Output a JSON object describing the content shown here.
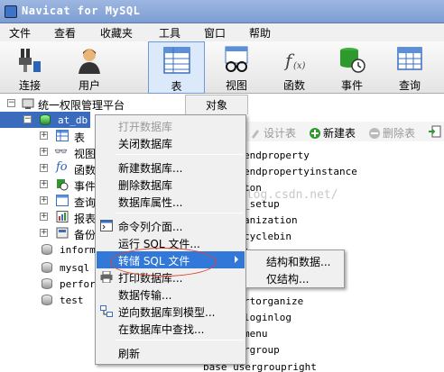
{
  "window": {
    "title": "Navicat for MySQL"
  },
  "menubar": [
    "文件",
    "查看",
    "收藏夹",
    "工具",
    "窗口",
    "帮助"
  ],
  "toolbar": [
    {
      "label": "连接",
      "icon": "connection-icon"
    },
    {
      "label": "用户",
      "icon": "user-icon"
    },
    {
      "label": "表",
      "icon": "table-icon",
      "active": true
    },
    {
      "label": "视图",
      "icon": "view-icon"
    },
    {
      "label": "函数",
      "icon": "function-icon"
    },
    {
      "label": "事件",
      "icon": "event-icon"
    },
    {
      "label": "查询",
      "icon": "query-icon"
    }
  ],
  "tree": {
    "root": "统一权限管理平台",
    "selected_db": "at_db",
    "children": [
      "表",
      "视图",
      "函数",
      "事件",
      "查询",
      "报表",
      "备份"
    ],
    "other_dbs": [
      "information_schema",
      "mysql",
      "performance_schema",
      "test"
    ],
    "visible_labels": {
      "info": "informa",
      "mysql": "mysql",
      "perf": "perform",
      "test": "test"
    }
  },
  "objects": {
    "tab": "对象",
    "toolbar": {
      "design": "设计表",
      "new": "新建表",
      "delete": "删除表"
    },
    "items": [
      "endproperty",
      "endpropertyinstance",
      "ton",
      "_setup",
      "anization",
      "cyclebin",
      "ion",
      "rtorganize",
      "loginlog",
      "menu",
      "rgroup",
      "base_usergroupright"
    ],
    "watermark": "blog.csdn.net/"
  },
  "context_menu": [
    {
      "label": "打开数据库",
      "disabled": true
    },
    {
      "label": "关闭数据库"
    },
    {
      "sep": true
    },
    {
      "label": "新建数据库..."
    },
    {
      "label": "删除数据库"
    },
    {
      "label": "数据库属性..."
    },
    {
      "sep": true
    },
    {
      "label": "命令列介面...",
      "icon": "console-icon"
    },
    {
      "label": "运行 SQL 文件..."
    },
    {
      "label": "转储 SQL 文件",
      "highlight": true,
      "submenu": true
    },
    {
      "label": "打印数据库...",
      "icon": "printer-icon"
    },
    {
      "label": "数据传输..."
    },
    {
      "label": "逆向数据库到模型...",
      "icon": "model-icon"
    },
    {
      "label": "在数据库中查找..."
    },
    {
      "sep": true
    },
    {
      "label": "刷新"
    }
  ],
  "submenu": [
    "结构和数据...",
    "仅结构..."
  ],
  "colors": {
    "highlight": "#3178d8",
    "selection": "#3b6bbd",
    "annotation": "#dd4433"
  }
}
